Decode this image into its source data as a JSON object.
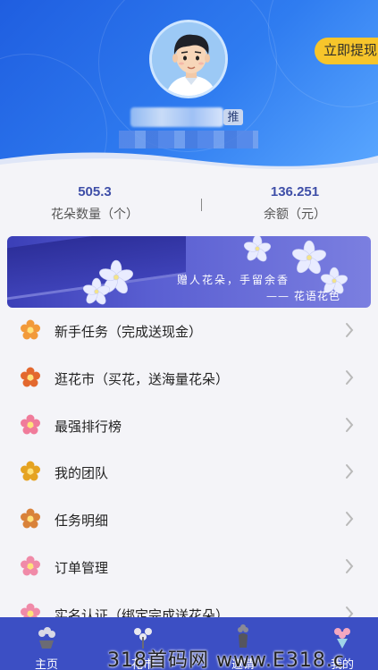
{
  "profile": {
    "withdraw_label": "立即提现",
    "tag": "推"
  },
  "stats": {
    "flowers": {
      "value": "505.3",
      "label": "花朵数量（个）"
    },
    "balance": {
      "value": "136.251",
      "label": "余额（元）"
    }
  },
  "banner": {
    "line1": "赠人花朵，手留余香",
    "line2": "—— 花语花色"
  },
  "menu": {
    "items": [
      {
        "label": "新手任务（完成送现金）",
        "icon": "flower-icon",
        "color": "#f29a3a"
      },
      {
        "label": "逛花市（买花，送海量花朵）",
        "icon": "bouquet-icon",
        "color": "#e3682e"
      },
      {
        "label": "最强排行榜",
        "icon": "blossom-icon",
        "color": "#f07b9a"
      },
      {
        "label": "我的团队",
        "icon": "flower-bunch-icon",
        "color": "#e5a321"
      },
      {
        "label": "任务明细",
        "icon": "deer-icon",
        "color": "#d9823a"
      },
      {
        "label": "订单管理",
        "icon": "pink-flower-icon",
        "color": "#f08aa8"
      },
      {
        "label": "实名认证（绑定完成送花朵）",
        "icon": "pink-flower-icon",
        "color": "#f08aa8"
      }
    ]
  },
  "tabbar": {
    "tabs": [
      {
        "label": "主页",
        "icon": "flower-pot-icon"
      },
      {
        "label": "花市",
        "icon": "flowers-icon"
      },
      {
        "label": "邀请",
        "icon": "vase-icon"
      },
      {
        "label": "我的",
        "icon": "bouquet-icon"
      }
    ]
  },
  "watermark": "318首码网 www.E318.c",
  "colors": {
    "header": "#2f7cf0",
    "accent": "#3f4fa8",
    "tabbar": "#3c4fc4",
    "withdraw": "#f7c52b"
  }
}
